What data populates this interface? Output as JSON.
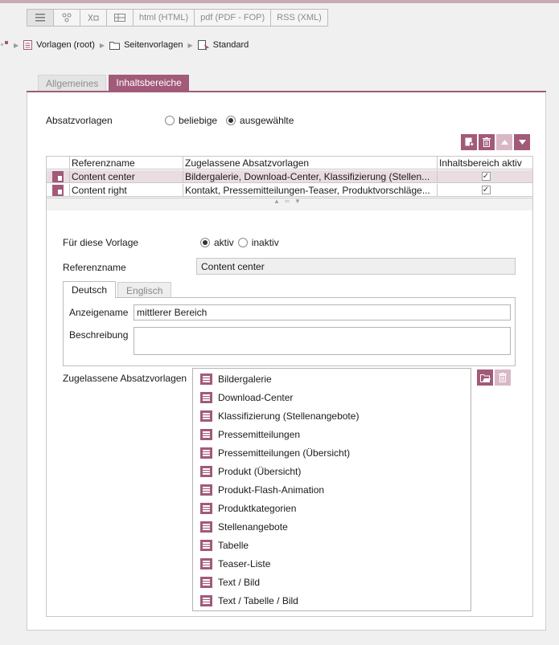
{
  "view_toolbar": {
    "buttons": [
      "html (HTML)",
      "pdf (PDF - FOP)",
      "RSS (XML)"
    ]
  },
  "breadcrumb": {
    "items": [
      "Vorlagen (root)",
      "Seitenvorlagen",
      "Standard"
    ]
  },
  "tabs": [
    "Allgemeines",
    "Inhaltsbereiche"
  ],
  "absatzvorlagen": {
    "label": "Absatzvorlagen",
    "options": [
      "beliebige",
      "ausgewählte"
    ],
    "selected": "ausgewählte"
  },
  "table": {
    "headers": [
      "Referenzname",
      "Zugelassene Absatzvorlagen",
      "Inhaltsbereich aktiv"
    ],
    "rows": [
      {
        "ref": "Content center",
        "allowed": "Bildergalerie, Download-Center, Klassifizierung (Stellen...",
        "active": "✓"
      },
      {
        "ref": "Content right",
        "allowed": "Kontakt, Pressemitteilungen-Teaser, Produktvorschläge...",
        "active": "✓"
      }
    ]
  },
  "detail": {
    "vorlage_label": "Für diese Vorlage",
    "vorlage_options": [
      "aktiv",
      "inaktiv"
    ],
    "vorlage_selected": "aktiv",
    "ref_label": "Referenzname",
    "ref_value": "Content center",
    "lang_tabs": [
      "Deutsch",
      "Englisch"
    ],
    "anzeigename_label": "Anzeigename",
    "anzeigename_value": "mittlerer Bereich",
    "beschreibung_label": "Beschreibung",
    "beschreibung_value": "",
    "allowed_label": "Zugelassene Absatzvorlagen",
    "allowed_items": [
      "Bildergalerie",
      "Download-Center",
      "Klassifizierung (Stellenangebote)",
      "Pressemitteilungen",
      "Pressemitteilungen (Übersicht)",
      "Produkt (Übersicht)",
      "Produkt-Flash-Animation",
      "Produktkategorien",
      "Stellenangebote",
      "Tabelle",
      "Teaser-Liste",
      "Text / Bild",
      "Text / Tabelle / Bild"
    ]
  },
  "colors": {
    "accent": "#a25a79",
    "accent_light": "#d9b8c6",
    "selected_row": "#eadde2"
  },
  "icons": [
    "list-view-icon",
    "tree-view-icon",
    "structure-view-icon",
    "table-view-icon",
    "folder-icon",
    "template-icon",
    "add-icon",
    "delete-icon",
    "move-up-icon",
    "move-down-icon",
    "edit-folder-icon"
  ]
}
